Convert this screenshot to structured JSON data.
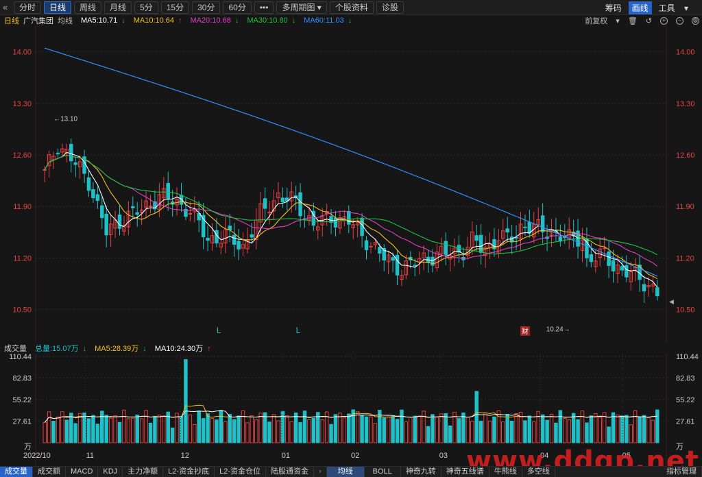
{
  "toolbar": {
    "back_icon": "double-chevron-left-icon",
    "buttons": [
      "分时",
      "日线",
      "周线",
      "月线",
      "5分",
      "15分",
      "30分",
      "60分",
      "•••",
      "多周期图",
      "个股资料",
      "诊股"
    ],
    "active": "日线",
    "right": [
      "筹码",
      "画线",
      "工具"
    ],
    "right_active": "画线"
  },
  "info": {
    "period": "日线",
    "stock": "广汽集团",
    "ma_label": "均线",
    "ma5": "MA5:10.71",
    "ma10": "MA10:10.64",
    "ma20": "MA20:10.68",
    "ma30": "MA30:10.80",
    "ma60": "MA60:11.03",
    "adjust": "前复权",
    "colors": {
      "ma5": "#ffffff",
      "ma10": "#f0c020",
      "ma20": "#e040c0",
      "ma30": "#20c040",
      "ma60": "#3090ff",
      "up": "#e84040",
      "down": "#20c0c8",
      "axis": "#e84040"
    }
  },
  "price_axis": [
    "14.00",
    "13.30",
    "12.60",
    "11.90",
    "11.20",
    "10.50"
  ],
  "annotations": {
    "high": "13.10",
    "low": "10.24",
    "markers": [
      "L",
      "L"
    ],
    "cai": "财"
  },
  "volume": {
    "label": "成交量",
    "total": "总量:15.07万",
    "ma5": "MA5:28.39万",
    "ma10": "MA10:24.30万",
    "axis": [
      "110.44",
      "82.83",
      "55.22",
      "27.61",
      "万"
    ]
  },
  "x_axis": [
    "2022/10",
    "11",
    "12",
    "01",
    "02",
    "03",
    "04",
    "05"
  ],
  "bottom_tabs": [
    "成交量",
    "成交额",
    "MACD",
    "KDJ",
    "主力净额",
    "L2-资金抄底",
    "L2-资金仓位",
    "陆股通资金",
    "均线",
    "BOLL",
    "神奇九转",
    "神奇五线谱",
    "牛熊线",
    "多空线",
    "指标管理"
  ],
  "bottom_active": [
    "成交量",
    "均线"
  ],
  "watermark": "www.ddgp.net"
}
